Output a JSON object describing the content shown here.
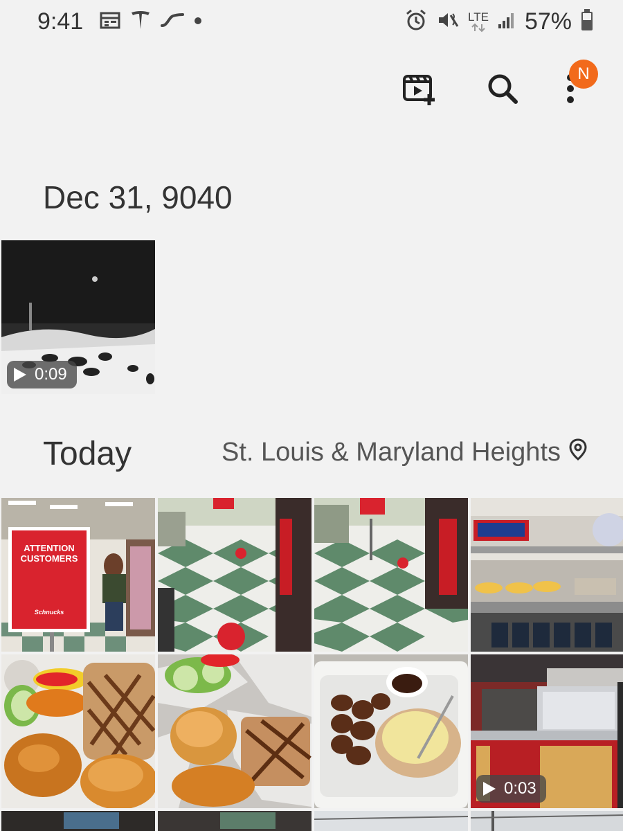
{
  "status_bar": {
    "time": "9:41",
    "network": "LTE",
    "battery": "57%",
    "left_icons": [
      "calendar-icon",
      "tesla-icon",
      "swipe-icon",
      "dot-icon"
    ],
    "right_icons": [
      "alarm-icon",
      "vibrate-mute-icon",
      "lte-icon",
      "signal-icon",
      "battery-icon"
    ]
  },
  "toolbar": {
    "icons": [
      "create-movie-icon",
      "search-icon",
      "more-options-icon"
    ],
    "notification_badge": "N",
    "badge_color": "#f26a1b"
  },
  "sections": [
    {
      "date": "Dec 31, 9040",
      "items": [
        {
          "type": "video",
          "duration": "0:09",
          "description": "night video"
        }
      ]
    },
    {
      "date": "Today",
      "location": "St. Louis & Maryland Heights",
      "items": [
        {
          "type": "photo",
          "sign_title": "ATTENTION CUSTOMERS",
          "sign_brand": "Schnucks"
        },
        {
          "type": "photo"
        },
        {
          "type": "photo"
        },
        {
          "type": "photo"
        },
        {
          "type": "photo"
        },
        {
          "type": "photo"
        },
        {
          "type": "photo"
        },
        {
          "type": "video",
          "duration": "0:03"
        }
      ]
    }
  ]
}
